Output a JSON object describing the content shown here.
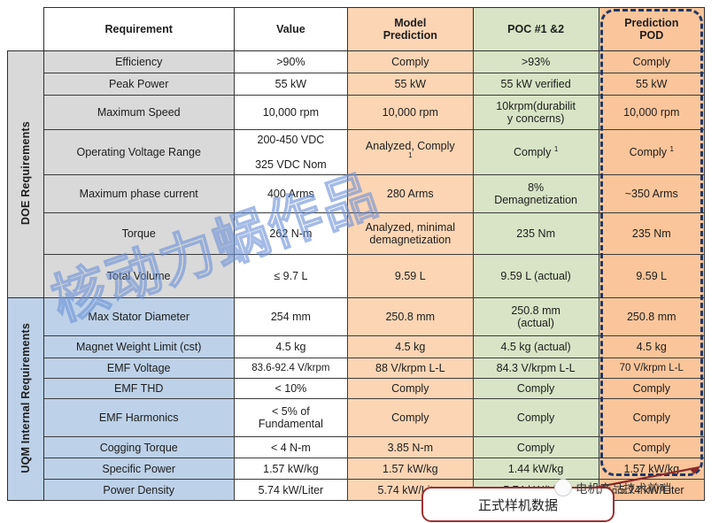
{
  "table": {
    "headers": [
      "",
      "Requirement",
      "Value",
      "Model\nPrediction",
      "POC #1 &2",
      "Prediction\nPOD"
    ],
    "header_labels": {
      "requirement": "Requirement",
      "value": "Value",
      "model_prediction_l1": "Model",
      "model_prediction_l2": "Prediction",
      "poc": "POC #1 &2",
      "pod_l1": "Prediction",
      "pod_l2": "POD"
    },
    "groups": [
      {
        "label": "DOE Requirements",
        "rows": [
          {
            "requirement": "Efficiency",
            "value": ">90%",
            "model": "Comply",
            "poc": ">93%",
            "pod": "Comply"
          },
          {
            "requirement": "Peak Power",
            "value": "55 kW",
            "model": "55 kW",
            "poc": "55 kW verified",
            "pod": "55 kW"
          },
          {
            "requirement": "Maximum Speed",
            "value": "10,000 rpm",
            "model": "10,000 rpm",
            "poc": "10krpm(durability concerns)",
            "pod": "10,000 rpm"
          },
          {
            "requirement": "Operating Voltage Range",
            "value": "200-450 VDC\n325 VDC Nom",
            "model": "Analyzed, Comply 1",
            "poc": "Comply 1",
            "pod": "Comply 1"
          },
          {
            "requirement": "Maximum phase current",
            "value": "400 Arms",
            "model": "280 Arms",
            "poc": "8% Demagnetization",
            "pod": "~350 Arms"
          },
          {
            "requirement": "Torque",
            "value": "262 N-m",
            "model": "Analyzed, minimal demagnetization",
            "poc": "235 Nm",
            "pod": "235 Nm"
          },
          {
            "requirement": "Total Volume",
            "value": "≤ 9.7 L",
            "model": "9.59 L",
            "poc": "9.59 L (actual)",
            "pod": "9.59 L"
          }
        ]
      },
      {
        "label": "UQM Internal Requirements",
        "rows": [
          {
            "requirement": "Max Stator Diameter",
            "value": "254 mm",
            "model": "250.8 mm",
            "poc": "250.8 mm (actual)",
            "pod": "250.8 mm"
          },
          {
            "requirement": "Magnet Weight Limit (cst)",
            "value": "4.5 kg",
            "model": "4.5 kg",
            "poc": "4.5 kg (actual)",
            "pod": "4.5 kg"
          },
          {
            "requirement": "EMF Voltage",
            "value": "83.6-92.4 V/krpm",
            "model": "88 V/krpm L-L",
            "poc": "84.3 V/krpm L-L",
            "pod": "70  V/krpm L-L"
          },
          {
            "requirement": "EMF THD",
            "value": "< 10%",
            "model": "Comply",
            "poc": "Comply",
            "pod": "Comply"
          },
          {
            "requirement": "EMF Harmonics",
            "value": "< 5% of\nFundamental",
            "model": "Comply",
            "poc": "Comply",
            "pod": "Comply"
          },
          {
            "requirement": "Cogging Torque",
            "value": "< 4 N-m",
            "model": "3.85 N-m",
            "poc": "Comply",
            "pod": "Comply"
          },
          {
            "requirement": "Specific Power",
            "value": "1.57 kW/kg",
            "model": "1.57 kW/kg",
            "poc": "1.44 kW/kg",
            "pod": "1.57 kW/kg"
          },
          {
            "requirement": "Power Density",
            "value": "5.74 kW/Liter",
            "model": "5.74 kW/Liter",
            "poc": "5.74 kW/Liter",
            "pod": "5.74 kW/Liter"
          }
        ]
      }
    ]
  },
  "annotations": {
    "callout_text": "正式样机数据",
    "brand_text": "电机产品技术前哨",
    "watermark_text": "核动力蜗作品"
  },
  "colors": {
    "orange": "#FBD5B4",
    "green": "#D8E4C5",
    "pod_orange": "#FAC59A",
    "gray": "#D9D9D9",
    "blue": "#BDD1E8",
    "pod_outline": "#1F3864",
    "callout_border": "#A03030"
  }
}
